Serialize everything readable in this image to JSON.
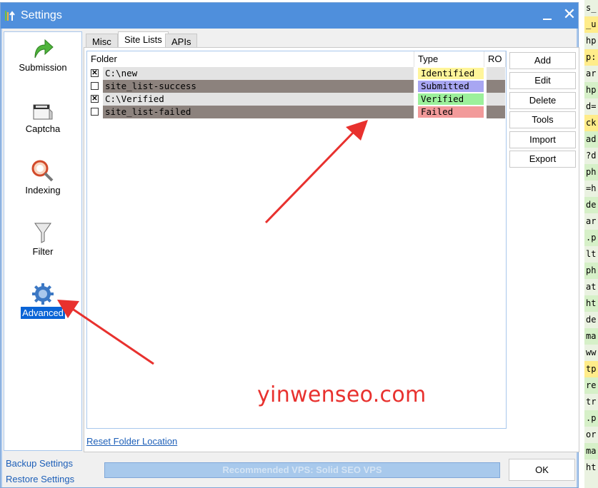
{
  "background_lines": [
    "s_ ",
    "_u",
    "hp",
    "p:",
    "ar",
    "hp",
    "d=",
    "ck",
    "ad",
    "?d",
    "ph",
    "=h",
    "de",
    "ar",
    ".p",
    "lt",
    "ph",
    "at",
    "ht",
    "de",
    "ma",
    "ww",
    "tp",
    "re",
    "tr",
    ".p",
    "or",
    "ma",
    "ht"
  ],
  "window": {
    "title": "Settings",
    "icon": "app-icon",
    "minimize_icon": "minimize-icon",
    "close_glyph": "✕"
  },
  "sidebar": {
    "items": [
      {
        "label": "Submission",
        "icon": "submission-arrow-icon"
      },
      {
        "label": "Captcha",
        "icon": "captcha-icon"
      },
      {
        "label": "Indexing",
        "icon": "indexing-icon"
      },
      {
        "label": "Filter",
        "icon": "filter-funnel-icon"
      },
      {
        "label": "Advanced",
        "icon": "advanced-gear-icon",
        "selected": true
      }
    ]
  },
  "tabs": [
    {
      "label": "Misc"
    },
    {
      "label": "Site Lists",
      "active": true
    },
    {
      "label": "APIs"
    }
  ],
  "table": {
    "columns": [
      "Folder",
      "Type",
      "RO"
    ],
    "rows": [
      {
        "checked": true,
        "folder": "C:\\new",
        "type": "Identified",
        "type_color": "#fff59a",
        "row_color": "#e3e3e3"
      },
      {
        "checked": false,
        "folder": "site_list-success",
        "type": "Submitted",
        "type_color": "#a8a6f2",
        "row_color": "#8c827d"
      },
      {
        "checked": true,
        "folder": "C:\\Verified",
        "type": "Verified",
        "type_color": "#9cf09b",
        "row_color": "#e3e3e3"
      },
      {
        "checked": false,
        "folder": "site_list-failed",
        "type": "Failed",
        "type_color": "#f29a9a",
        "row_color": "#8c827d"
      }
    ]
  },
  "actions": [
    "Add",
    "Edit",
    "Delete",
    "Tools",
    "Import",
    "Export"
  ],
  "reset_link": "Reset Folder Location",
  "backup_link": "Backup Settings",
  "restore_link": "Restore Settings",
  "vps_bar": "Recommended VPS: Solid SEO VPS",
  "ok_label": "OK",
  "watermark": "yinwenseo.com",
  "annotation_color": "#e8312e"
}
